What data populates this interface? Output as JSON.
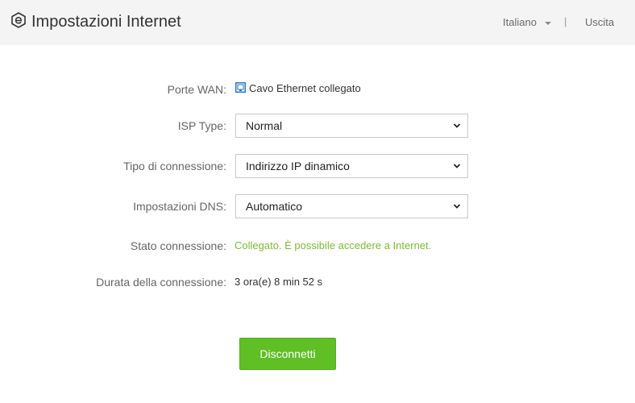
{
  "header": {
    "title": "Impostazioni Internet",
    "language": "Italiano",
    "separator": "|",
    "logout": "Uscita",
    "logo_icon": "router-e-logo-icon"
  },
  "wan": {
    "label": "Porte WAN:",
    "icon": "ethernet-port-icon",
    "status": "Cavo Ethernet collegato"
  },
  "isp_type": {
    "label": "ISP Type:",
    "value": "Normal"
  },
  "connection_type": {
    "label": "Tipo di connessione:",
    "value": "Indirizzo IP dinamico"
  },
  "dns": {
    "label": "Impostazioni DNS:",
    "value": "Automatico"
  },
  "connection_status": {
    "label": "Stato connessione:",
    "value": "Collegato. È possibile accedere a Internet.",
    "color": "#7dbb2d"
  },
  "connection_duration": {
    "label": "Durata della connessione:",
    "value": "3 ora(e) 8 min 52 s"
  },
  "actions": {
    "disconnect": "Disconnetti",
    "button_color": "#5fbf24"
  }
}
